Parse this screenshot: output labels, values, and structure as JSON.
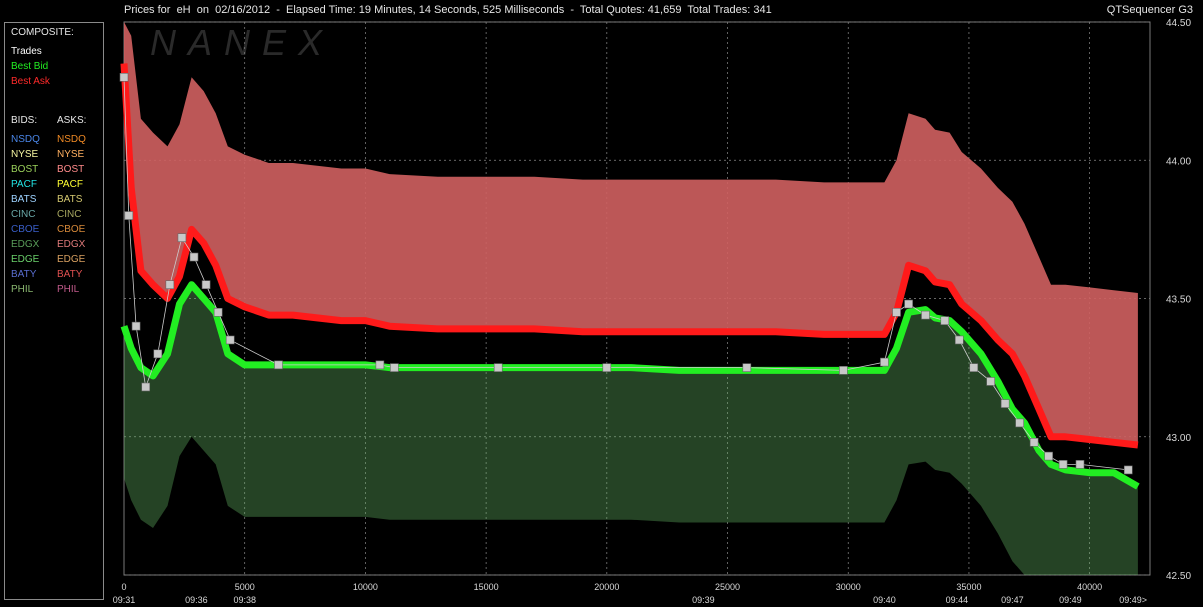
{
  "header": {
    "title": "Prices for  eH  on  02/16/2012  -  Elapsed Time: 19 Minutes, 14 Seconds, 525 Milliseconds  -  Total Quotes: 41,659  Total Trades: 341",
    "app_name": "QTSequencer G3",
    "watermark": "NANEX"
  },
  "legend": {
    "composite_title": "COMPOSITE:",
    "composite": [
      {
        "label": "Trades",
        "color": "#ffffff"
      },
      {
        "label": "Best Bid",
        "color": "#22ee22"
      },
      {
        "label": "Best Ask",
        "color": "#ff2a2a"
      }
    ],
    "bids_title": "BIDS:",
    "asks_title": "ASKS:",
    "exchanges": [
      {
        "bid": "NSDQ",
        "ask": "NSDQ",
        "bid_color": "#4a86e8",
        "ask_color": "#f08a24"
      },
      {
        "bid": "NYSE",
        "ask": "NYSE",
        "bid_color": "#f5f5a0",
        "ask_color": "#ffb060"
      },
      {
        "bid": "BOST",
        "ask": "BOST",
        "bid_color": "#9ad05a",
        "ask_color": "#ff8a8a"
      },
      {
        "bid": "PACF",
        "ask": "PACF",
        "bid_color": "#22e5e5",
        "ask_color": "#ffff33"
      },
      {
        "bid": "BATS",
        "ask": "BATS",
        "bid_color": "#9ed2ff",
        "ask_color": "#d4c870"
      },
      {
        "bid": "CINC",
        "ask": "CINC",
        "bid_color": "#6aa8a8",
        "ask_color": "#a8a860"
      },
      {
        "bid": "CBOE",
        "ask": "CBOE",
        "bid_color": "#3a5ec8",
        "ask_color": "#d88a3a"
      },
      {
        "bid": "EDGX",
        "ask": "EDGX",
        "bid_color": "#5a9e5a",
        "ask_color": "#e07a7a"
      },
      {
        "bid": "EDGE",
        "ask": "EDGE",
        "bid_color": "#6ad06a",
        "ask_color": "#d8a060"
      },
      {
        "bid": "BATY",
        "ask": "BATY",
        "bid_color": "#5a6ed0",
        "ask_color": "#e05050"
      },
      {
        "bid": "PHIL",
        "ask": "PHIL",
        "bid_color": "#8ab870",
        "ask_color": "#c05a8a"
      }
    ]
  },
  "chart_data": {
    "type": "line",
    "title": "",
    "xlabel": "",
    "ylabel": "",
    "xlim": [
      0,
      42500
    ],
    "ylim": [
      42.5,
      44.5
    ],
    "x_ticks": [
      0,
      5000,
      10000,
      15000,
      20000,
      25000,
      30000,
      35000,
      40000
    ],
    "y_ticks": [
      42.5,
      43.0,
      43.5,
      44.0,
      44.5
    ],
    "y_tick_labels": [
      "42.50",
      "43.00",
      "43.50",
      "44.00",
      "44.50"
    ],
    "time_labels": [
      {
        "x": 0,
        "label": "09:31"
      },
      {
        "x": 3000,
        "label": "09:36"
      },
      {
        "x": 5000,
        "label": "09:38"
      },
      {
        "x": 24000,
        "label": "09:39"
      },
      {
        "x": 31500,
        "label": "09:40"
      },
      {
        "x": 34500,
        "label": "09:44"
      },
      {
        "x": 36800,
        "label": "09:47"
      },
      {
        "x": 39200,
        "label": "09:49"
      },
      {
        "x": 41800,
        "label": "09:49>"
      }
    ],
    "grid": true,
    "series": [
      {
        "name": "Best Ask",
        "color": "#ff1a1a",
        "x": [
          0,
          300,
          700,
          1200,
          1800,
          2300,
          2800,
          3300,
          3800,
          4300,
          5000,
          6000,
          7000,
          8000,
          9000,
          10000,
          11000,
          13000,
          15000,
          17000,
          19000,
          21000,
          23000,
          25000,
          27000,
          29000,
          30500,
          31500,
          32000,
          32500,
          33200,
          33600,
          34200,
          34700,
          35500,
          36200,
          36800,
          37300,
          37900,
          38400,
          39000,
          40000,
          41000,
          42000
        ],
        "y": [
          44.35,
          43.9,
          43.6,
          43.55,
          43.5,
          43.58,
          43.75,
          43.7,
          43.62,
          43.5,
          43.47,
          43.44,
          43.44,
          43.43,
          43.42,
          43.42,
          43.4,
          43.39,
          43.39,
          43.39,
          43.38,
          43.38,
          43.38,
          43.38,
          43.38,
          43.37,
          43.37,
          43.37,
          43.45,
          43.62,
          43.6,
          43.56,
          43.55,
          43.48,
          43.42,
          43.35,
          43.3,
          43.22,
          43.1,
          43.0,
          43.0,
          42.99,
          42.98,
          42.97
        ]
      },
      {
        "name": "Best Bid",
        "color": "#22ee22",
        "x": [
          0,
          300,
          700,
          1200,
          1800,
          2300,
          2800,
          3300,
          3800,
          4300,
          5000,
          6000,
          7000,
          8000,
          9000,
          10000,
          11000,
          13000,
          15000,
          17000,
          19000,
          21000,
          23000,
          25000,
          27000,
          29000,
          30500,
          31500,
          32000,
          32500,
          33200,
          33600,
          34200,
          34700,
          35500,
          36200,
          36800,
          37300,
          37900,
          38400,
          39000,
          40000,
          41000,
          42000
        ],
        "y": [
          43.4,
          43.32,
          43.25,
          43.22,
          43.3,
          43.48,
          43.55,
          43.5,
          43.45,
          43.3,
          43.26,
          43.26,
          43.26,
          43.26,
          43.26,
          43.26,
          43.25,
          43.25,
          43.25,
          43.25,
          43.25,
          43.25,
          43.24,
          43.24,
          43.24,
          43.24,
          43.24,
          43.24,
          43.32,
          43.45,
          43.46,
          43.43,
          43.42,
          43.38,
          43.3,
          43.2,
          43.1,
          43.05,
          42.95,
          42.9,
          42.88,
          42.87,
          42.87,
          42.82
        ]
      },
      {
        "name": "Trades",
        "color": "#ffffff",
        "x": [
          0,
          200,
          500,
          900,
          1400,
          1900,
          2400,
          2900,
          3400,
          3900,
          4400,
          6400,
          10600,
          11200,
          15500,
          20000,
          25800,
          29800,
          31500,
          32000,
          32500,
          33200,
          34000,
          34600,
          35200,
          35900,
          36500,
          37100,
          37700,
          38300,
          38900,
          39600,
          41600
        ],
        "y": [
          44.3,
          43.8,
          43.4,
          43.18,
          43.3,
          43.55,
          43.72,
          43.65,
          43.55,
          43.45,
          43.35,
          43.26,
          43.26,
          43.25,
          43.25,
          43.25,
          43.25,
          43.24,
          43.27,
          43.45,
          43.48,
          43.44,
          43.42,
          43.35,
          43.25,
          43.2,
          43.12,
          43.05,
          42.98,
          42.93,
          42.9,
          42.9,
          42.88
        ]
      }
    ]
  }
}
